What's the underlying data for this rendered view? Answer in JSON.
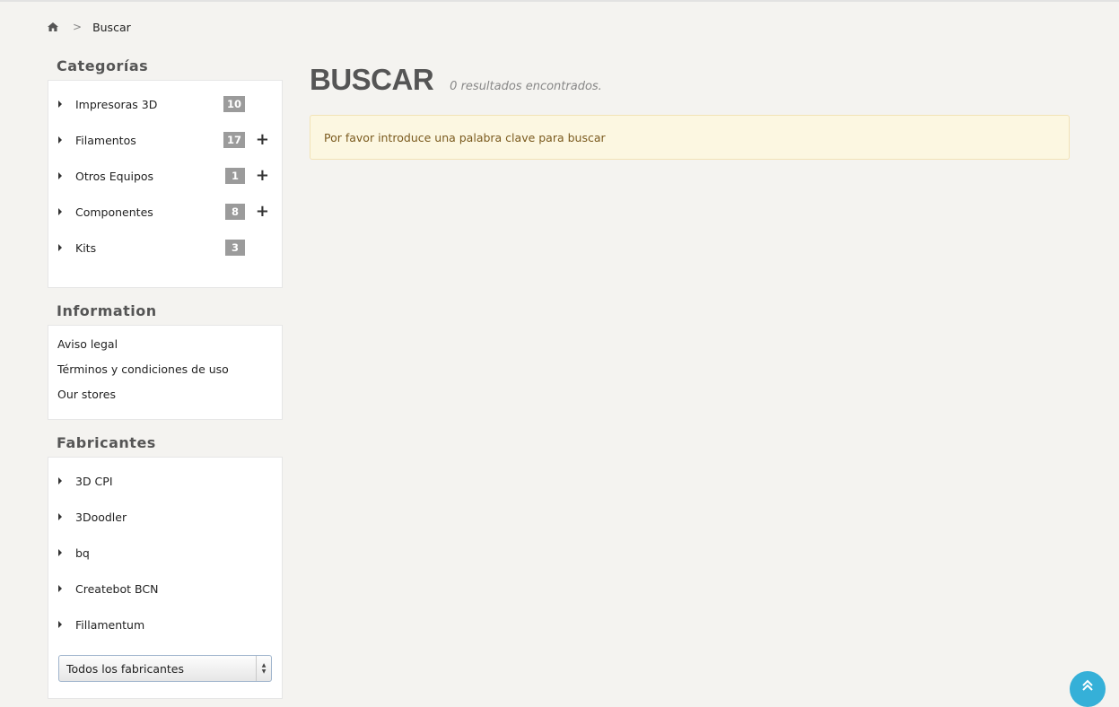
{
  "breadcrumb": {
    "home_icon": "home-icon",
    "separator": ">",
    "current": "Buscar"
  },
  "categories": {
    "title": "Categorías",
    "items": [
      {
        "label": "Impresoras 3D",
        "count": "10",
        "expandable": false
      },
      {
        "label": "Filamentos",
        "count": "17",
        "expandable": true
      },
      {
        "label": "Otros Equipos",
        "count": "1",
        "expandable": true
      },
      {
        "label": "Componentes",
        "count": "8",
        "expandable": true
      },
      {
        "label": "Kits",
        "count": "3",
        "expandable": false
      }
    ],
    "expand_symbol": "+"
  },
  "information": {
    "title": "Information",
    "links": [
      "Aviso legal",
      "Términos y condiciones de uso",
      "Our stores"
    ]
  },
  "manufacturers": {
    "title": "Fabricantes",
    "items": [
      "3D CPI",
      "3Doodler",
      "bq",
      "Createbot BCN",
      "Fillamentum"
    ],
    "select_value": "Todos los fabricantes"
  },
  "main": {
    "title": "BUSCAR",
    "results_text": "0 resultados encontrados.",
    "alert_text": "Por favor introduce una palabra clave para buscar"
  },
  "colors": {
    "accent": "#35b0d8",
    "badge": "#9b9b9b",
    "alert_bg": "#fcf7e1",
    "alert_text": "#7a5a1e"
  }
}
